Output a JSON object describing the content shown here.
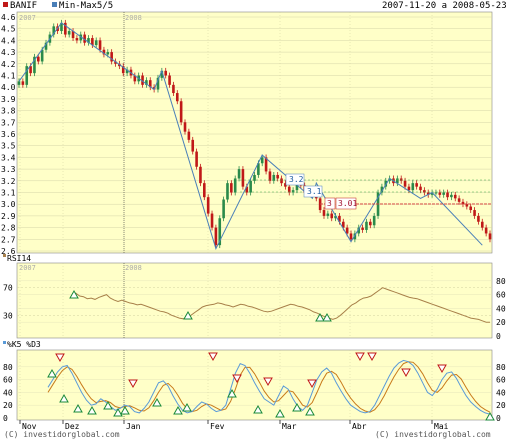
{
  "header": {
    "ticker": "BANIF",
    "indicator": "Min-Max5/5",
    "date_range": "2007-11-20 a 2008-05-23"
  },
  "footer": {
    "left": "(C) investidorglobal.com",
    "right": "(C) investidorglobal.com"
  },
  "colors": {
    "panel_bg": "#ffffc8",
    "up_candle": "#2a8a4a",
    "down_candle": "#c01818",
    "zigzag": "#4a7fb8",
    "rsi": "#a8804a",
    "k_line": "#5a9ad8",
    "d_line": "#c87a1a",
    "buy_marker": "#1a8a3a",
    "sell_marker": "#c01818",
    "support": "#d04040"
  },
  "chart_data": [
    {
      "type": "candlestick",
      "title": "BANIF",
      "overlay": "Min-Max5/5",
      "year_labels": [
        "2007",
        "2008"
      ],
      "x_tick_labels": [
        "Nov",
        "Dez",
        "Jan",
        "Fev",
        "Mar",
        "Abr",
        "Mai"
      ],
      "y_tick_labels": [
        "4.6",
        "4.5",
        "4.4",
        "4.3",
        "4.2",
        "4.1",
        "4.0",
        "3.9",
        "3.8",
        "3.7",
        "3.6",
        "3.5",
        "3.4",
        "3.3",
        "3.2",
        "3.1",
        "3.0",
        "2.9",
        "2.8",
        "2.7",
        "2.6"
      ],
      "ylim": [
        2.6,
        4.6
      ],
      "close": [
        4.05,
        4.02,
        4.18,
        4.12,
        4.26,
        4.22,
        4.32,
        4.38,
        4.45,
        4.52,
        4.48,
        4.55,
        4.45,
        4.48,
        4.42,
        4.4,
        4.45,
        4.38,
        4.42,
        4.36,
        4.4,
        4.32,
        4.28,
        4.3,
        4.22,
        4.2,
        4.18,
        4.12,
        4.15,
        4.1,
        4.05,
        4.1,
        4.02,
        4.06,
        4.0,
        3.98,
        4.08,
        4.14,
        4.1,
        4.02,
        3.95,
        3.88,
        3.7,
        3.62,
        3.55,
        3.45,
        3.32,
        3.18,
        3.06,
        2.92,
        2.8,
        2.65,
        2.88,
        3.04,
        3.18,
        3.1,
        3.22,
        3.3,
        3.15,
        3.1,
        3.2,
        3.25,
        3.35,
        3.4,
        3.28,
        3.2,
        3.25,
        3.22,
        3.18,
        3.15,
        3.1,
        3.12,
        3.18,
        3.16,
        3.1,
        3.12,
        3.08,
        3.05,
        2.95,
        2.9,
        2.92,
        2.88,
        2.9,
        2.85,
        2.8,
        2.75,
        2.7,
        2.75,
        2.8,
        2.78,
        2.85,
        2.82,
        2.9,
        3.1,
        3.15,
        3.2,
        3.22,
        3.18,
        3.22,
        3.2,
        3.15,
        3.12,
        3.18,
        3.15,
        3.12,
        3.1,
        3.08,
        3.1,
        3.1,
        3.08,
        3.1,
        3.06,
        3.08,
        3.05,
        3.02,
        3.0,
        2.98,
        2.95,
        2.9,
        2.85,
        2.8,
        2.75,
        2.7
      ],
      "zigzag": [
        {
          "i": 0,
          "v": 4.05
        },
        {
          "i": 11,
          "v": 4.55
        },
        {
          "i": 35,
          "v": 3.98
        },
        {
          "i": 37,
          "v": 4.14
        },
        {
          "i": 51,
          "v": 2.62
        },
        {
          "i": 63,
          "v": 3.42
        },
        {
          "i": 76,
          "v": 3.05
        },
        {
          "i": 77,
          "v": 3.18
        },
        {
          "i": 86,
          "v": 2.68
        },
        {
          "i": 96,
          "v": 3.22
        },
        {
          "i": 104,
          "v": 3.05
        },
        {
          "i": 107,
          "v": 3.1
        },
        {
          "i": 120,
          "v": 2.65
        }
      ],
      "level_labels": [
        {
          "text": "3.2",
          "value": 3.2
        },
        {
          "text": "3.1",
          "value": 3.1
        },
        {
          "text": "3",
          "value": 3.0
        },
        {
          "text": "3.01",
          "value": 3.01
        }
      ]
    },
    {
      "type": "line",
      "title": "RSI14",
      "year_labels": [
        "2007",
        "2008"
      ],
      "y_tick_labels_left": [
        "70",
        "30"
      ],
      "y_tick_labels_right": [
        "80",
        "60",
        "40",
        "20",
        "0"
      ],
      "ylim": [
        0,
        100
      ],
      "series": [
        {
          "name": "RSI14",
          "values": [
            60,
            62,
            58,
            57,
            54,
            55,
            53,
            56,
            58,
            60,
            55,
            52,
            50,
            52,
            50,
            48,
            47,
            45,
            46,
            44,
            42,
            40,
            38,
            36,
            35,
            33,
            30,
            28,
            26,
            25,
            27,
            30,
            34,
            38,
            42,
            44,
            45,
            46,
            48,
            47,
            45,
            44,
            42,
            44,
            46,
            45,
            43,
            42,
            40,
            38,
            36,
            35,
            36,
            38,
            40,
            42,
            44,
            46,
            45,
            43,
            42,
            40,
            38,
            35,
            33,
            30,
            28,
            26,
            24,
            26,
            30,
            35,
            40,
            45,
            48,
            52,
            55,
            56,
            58,
            62,
            66,
            70,
            68,
            66,
            64,
            62,
            60,
            58,
            56,
            55,
            54,
            52,
            50,
            48,
            46,
            44,
            42,
            40,
            38,
            36,
            34,
            32,
            30,
            28,
            26,
            25,
            24,
            22,
            20,
            20
          ]
        }
      ],
      "buy_markers": [
        15,
        82,
        228,
        263,
        268
      ]
    },
    {
      "type": "line",
      "title": "%K5 %D3",
      "y_tick_labels_left": [
        "80",
        "60",
        "40",
        "20",
        "0"
      ],
      "y_tick_labels_right": [
        "80",
        "60",
        "40",
        "20",
        "0"
      ],
      "ylim": [
        0,
        100
      ],
      "series": [
        {
          "name": "%K5",
          "values": [
            48,
            60,
            72,
            80,
            82,
            70,
            55,
            40,
            28,
            20,
            22,
            30,
            25,
            18,
            12,
            15,
            20,
            18,
            10,
            8,
            15,
            25,
            40,
            55,
            58,
            50,
            35,
            22,
            12,
            8,
            10,
            18,
            25,
            22,
            15,
            10,
            12,
            20,
            45,
            70,
            85,
            82,
            70,
            55,
            42,
            30,
            25,
            20,
            35,
            50,
            45,
            30,
            18,
            12,
            20,
            40,
            60,
            72,
            78,
            70,
            55,
            42,
            30,
            20,
            15,
            10,
            8,
            10,
            20,
            35,
            50,
            65,
            78,
            86,
            90,
            88,
            82,
            70,
            55,
            40,
            35,
            45,
            60,
            70,
            72,
            62,
            48,
            35,
            25,
            18,
            12,
            8,
            6
          ]
        },
        {
          "name": "%D3",
          "values": [
            40,
            52,
            64,
            74,
            80,
            76,
            65,
            52,
            40,
            30,
            24,
            26,
            27,
            24,
            18,
            16,
            18,
            19,
            16,
            12,
            11,
            16,
            27,
            40,
            51,
            54,
            47,
            36,
            23,
            14,
            10,
            12,
            18,
            22,
            20,
            16,
            12,
            14,
            26,
            45,
            67,
            79,
            79,
            69,
            56,
            42,
            32,
            25,
            27,
            35,
            43,
            41,
            31,
            20,
            17,
            24,
            40,
            57,
            70,
            73,
            68,
            56,
            42,
            31,
            22,
            15,
            11,
            9,
            13,
            22,
            35,
            50,
            64,
            76,
            85,
            88,
            87,
            80,
            69,
            55,
            43,
            40,
            47,
            58,
            67,
            68,
            61,
            48,
            36,
            26,
            18,
            13,
            9
          ]
        }
      ],
      "buy_markers": [
        0,
        1,
        2,
        3,
        4,
        5,
        6,
        7,
        8,
        9,
        10,
        11,
        12,
        13,
        14
      ],
      "sell_markers": [
        0,
        1,
        2,
        3,
        4,
        5,
        6,
        7,
        8,
        9,
        10,
        11
      ]
    }
  ]
}
